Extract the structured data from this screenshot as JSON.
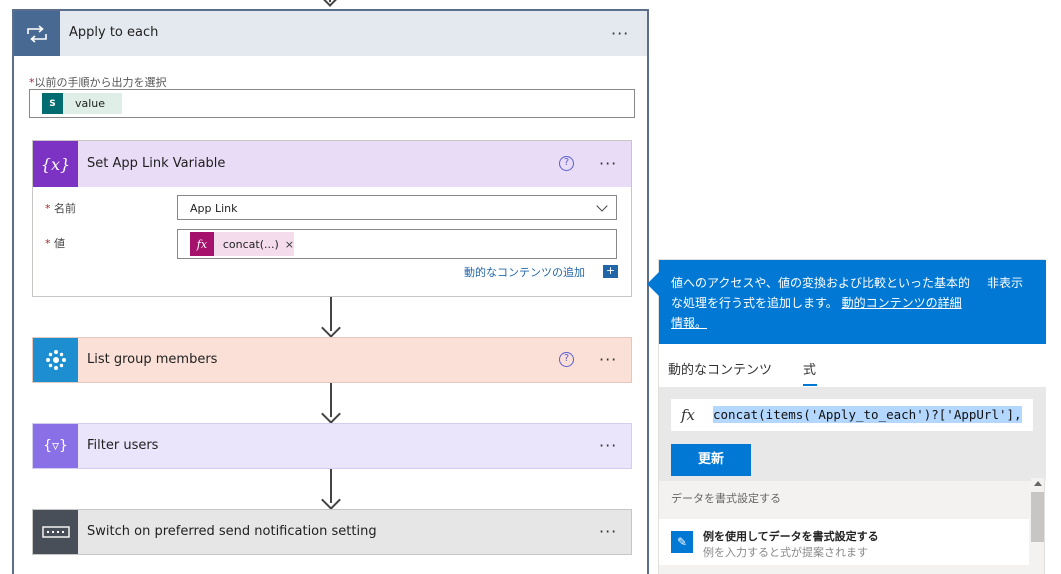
{
  "apply": {
    "title": "Apply to each",
    "more": "···",
    "select_label": "以前の手順から出力を選択",
    "required_mark": "*",
    "token": {
      "text": "value",
      "icon": "sharepoint-icon",
      "icon_text": "S"
    }
  },
  "set_var": {
    "title": "Set App Link Variable",
    "help": "?",
    "more": "···",
    "name_label": "名前",
    "name_value": "App Link",
    "value_label": "値",
    "token_text": "concat(...)",
    "token_close": "×",
    "fx_text": "fx",
    "dynamic_link": "動的なコンテンツの追加",
    "plus": "+",
    "color": "#7c33c4"
  },
  "list_members": {
    "title": "List group members",
    "help": "?",
    "more": "···",
    "color": "#1d8fd1"
  },
  "filter": {
    "title": "Filter users",
    "more": "···",
    "color": "#8a70e6"
  },
  "switch": {
    "title": "Switch on preferred send notification setting",
    "more": "···",
    "color": "#484f58"
  },
  "panel": {
    "callout_text": "値へのアクセスや、値の変換および比較といった基本的な処理を行う式を追加します。",
    "callout_link": "動的コンテンツの詳細情報。",
    "hide": "非表示",
    "tab_dynamic": "動的なコンテンツ",
    "tab_expression": "式",
    "expr_fx": "fx",
    "expression": "concat(items('Apply_to_each')?['AppUrl'],",
    "update_button": "更新",
    "section_label": "データを書式設定する",
    "item_title": "例を使用してデータを書式設定する",
    "item_sub": "例を入力すると式が提案されます"
  }
}
